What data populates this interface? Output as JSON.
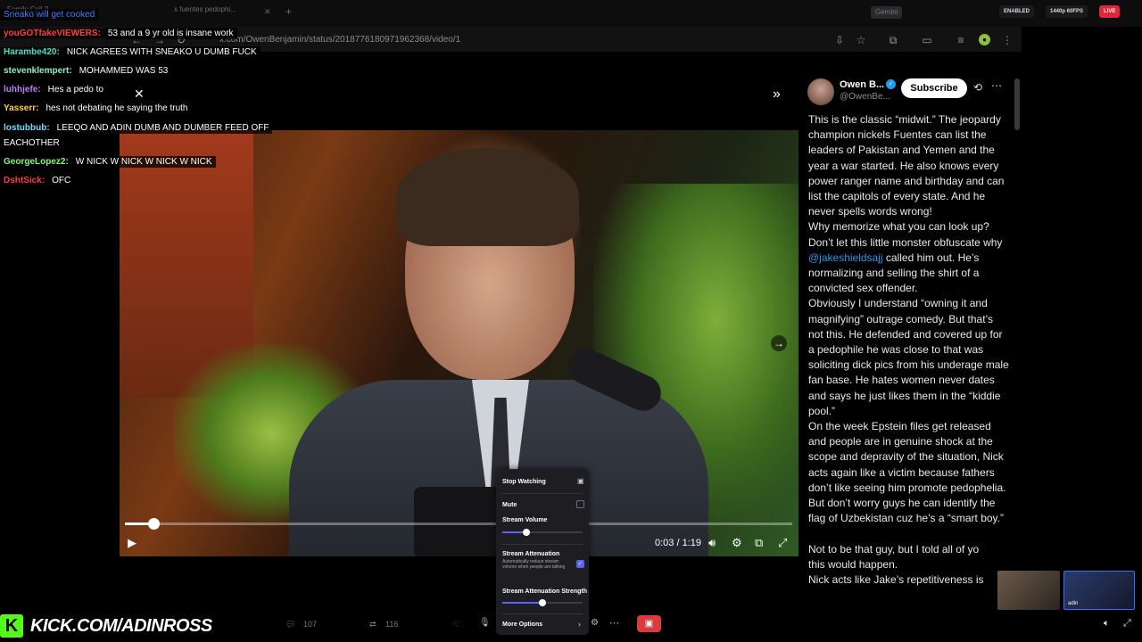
{
  "browser": {
    "tabs": [
      "Family Call 2",
      "x fuentes pedophi..."
    ],
    "url": "x.com/OwenBenjamin/status/2018776180971962368/video/1",
    "gemini_label": "Gemini",
    "status_enabled": "ENABLED",
    "status_quality": "1440p 60FPS",
    "status_live": "LIVE"
  },
  "chat": [
    {
      "user": "",
      "message": "Sneako will get cooked",
      "color": "#4a7dff"
    },
    {
      "user": "youGOTfakeVIEWERS:",
      "message": "53 and a 9 yr old is insane work",
      "color": "#ff3b3b"
    },
    {
      "user": "Harambe420:",
      "message": "NICK AGREES WITH SNEAKO U DUMB FUCK",
      "color": "#45e0c5"
    },
    {
      "user": "stevenklempert:",
      "message": "MOHAMMED WAS 53",
      "color": "#8ff0c8"
    },
    {
      "user": "luhhjefe:",
      "message": "Hes a pedo to",
      "color": "#c07bff"
    },
    {
      "user": "Yasserr:",
      "message": "hes not debating he saying the truth",
      "color": "#ffd24a"
    },
    {
      "user": "lostubbub:",
      "message": "LEEQO AND ADIN DUMB AND DUMBER FEED OFF",
      "color": "#7ad9ff"
    },
    {
      "user": "",
      "message": "EACHOTHER",
      "color": "#ffffff"
    },
    {
      "user": "GeorgeLopez2:",
      "message": "W NICK  W NICK  W NICK  W NICK",
      "color": "#7dff6a"
    },
    {
      "user": "DshtSick:",
      "message": "OFC",
      "color": "#ff3b3b"
    }
  ],
  "video": {
    "time_display": "0:03 / 1:19",
    "progress": 0.043
  },
  "tweet": {
    "name": "Owen B...",
    "handle": "@OwenBe...",
    "subscribe_label": "Subscribe",
    "body_part1": "This is the classic “midwit.” The jeopardy champion nickels Fuentes can list the leaders of Pakistan and Yemen and the year a war started. He also knows every power ranger name and birthday and can list the capitols of every state. And he never spells words wrong!\nWhy memorize what you can look up? Don’t let this little monster obfuscate why ",
    "mention": "@jakeshieldsajj",
    "body_part2": " called him out. He’s normalizing and selling the shirt of a convicted sex offender.\nObviously I understand “owning it and magnifying” outrage comedy. But that’s not this. He defended and covered up for a pedophile he was close to that was soliciting dick pics from his underage male fan base. He hates women never dates and says he just likes them in the “kiddie pool.”\nOn the week Epstein files get released and people are in genuine shock at the scope and depravity of the situation, Nick acts again like a victim because fathers don’t like seeing him promote pedophelia.\nBut don’t worry guys he can identify the flag of Uzbekistan cuz he’s a “smart boy.”\n\nNot to be that guy, but I told all of yo\nthis would happen.\nNick acts like Jake’s repetitiveness is"
  },
  "stream_menu": {
    "stop_watching": "Stop Watching",
    "mute": "Mute",
    "stream_volume": "Stream Volume",
    "volume_level": 0.3,
    "attenuation": "Stream Attenuation",
    "attenuation_desc": "Automatically reduce stream volume when people are talking",
    "attenuation_enabled": true,
    "attenuation_strength": "Stream Attenuation Strength",
    "strength_level": 0.5,
    "more_options": "More Options"
  },
  "kick": {
    "logo_letter": "K",
    "url_text": "KICK.COM/ADINROSS"
  },
  "stats": {
    "replies": "107",
    "reposts": "116"
  },
  "cam_label": "adin",
  "colors": {
    "kick_green": "#53fc18",
    "x_blue": "#1d9bf0",
    "discord_blurple": "#5865f2",
    "live_red": "#e0263a"
  }
}
